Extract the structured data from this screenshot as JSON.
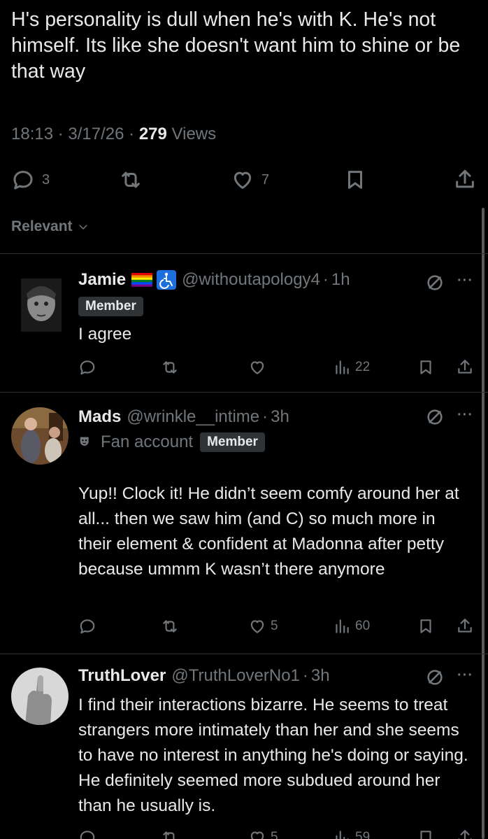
{
  "post": {
    "text": "H's personality is dull when he's with K. He's not himself. Its like she doesn't want him to shine or be that way",
    "time": "18:13",
    "date": "3/17/26",
    "views_count": "279",
    "views_label": "Views",
    "sep": "·",
    "replies": "3",
    "likes": "7"
  },
  "sort": {
    "label": "Relevant"
  },
  "replies": [
    {
      "name": "Jamie",
      "handle": "@withoutapology4",
      "time": "1h",
      "badge": "Member",
      "text": "I agree",
      "likes": "",
      "views": "22"
    },
    {
      "name": "Mads",
      "handle": "@wrinkle__intime",
      "time": "3h",
      "account_type": "Fan account",
      "badge": "Member",
      "text": "Yup!! Clock it! He didn’t seem comfy around her at all... then we saw him (and C) so much more in their element & confident at Madonna after petty because ummm K wasn’t there anymore",
      "likes": "5",
      "views": "60"
    },
    {
      "name": "TruthLover",
      "handle": "@TruthLoverNo1",
      "time": "3h",
      "text": "I find their interactions bizarre. He seems to treat strangers more intimately than her and she seems to have no interest in anything he's doing or saying. He definitely seemed more subdued around her than he usually is.",
      "likes": "5",
      "views": "59"
    }
  ],
  "icons": {
    "reply": "reply-icon",
    "retweet": "retweet-icon",
    "like": "heart-icon",
    "bookmark": "bookmark-icon",
    "share": "share-icon",
    "views": "views-icon",
    "grok": "grok-icon",
    "more": "more-icon"
  },
  "colors": {
    "background": "#000000",
    "text": "#e7e9ea",
    "muted": "#71767b",
    "divider": "#2f3336"
  }
}
